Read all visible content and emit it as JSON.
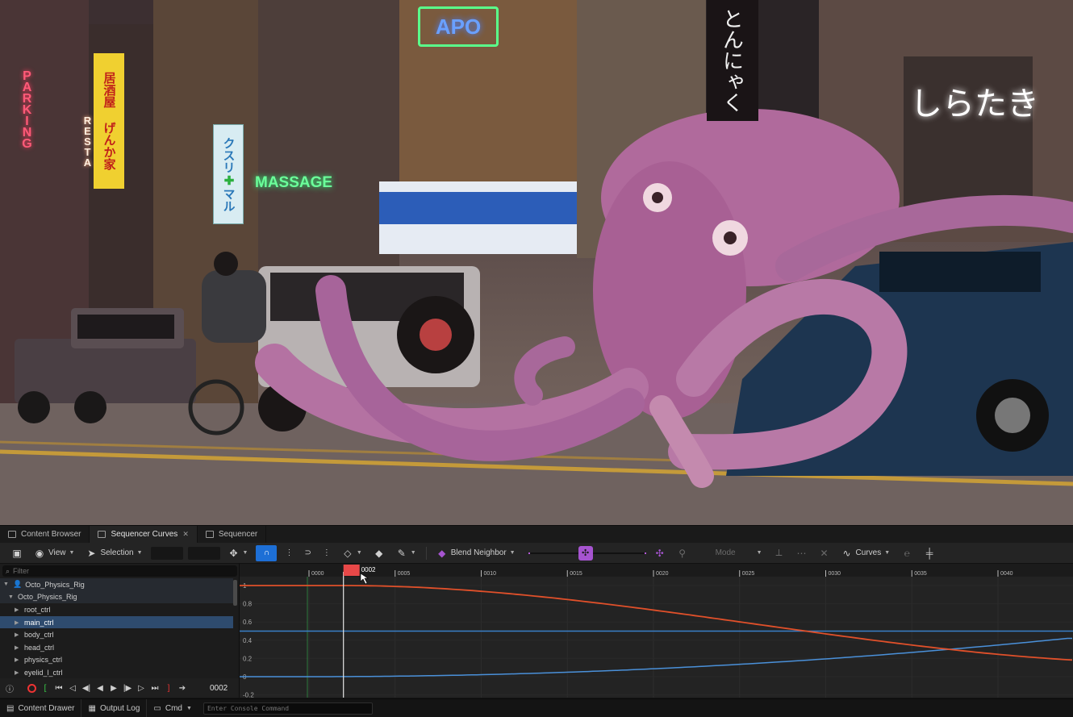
{
  "viewport": {
    "signs": {
      "parking": "PARKING",
      "resta": "RESTA",
      "massage": "MASSAGE",
      "apo": "APO",
      "kusuri": "クスリ",
      "maru": "マル",
      "vertical_right": "とんにゃく",
      "shirataki": "しらたき",
      "izakaya": "居酒屋 げんか家"
    }
  },
  "tabs": [
    {
      "label": "Content Browser",
      "icon": "folder-icon"
    },
    {
      "label": "Sequencer Curves",
      "icon": "curves-icon",
      "active": true
    },
    {
      "label": "Sequencer",
      "icon": "film-icon"
    }
  ],
  "toolbar": {
    "view_label": "View",
    "selection_label": "Selection",
    "blend_label": "Blend Neighbor",
    "mode_label": "Mode",
    "curves_label": "Curves",
    "accent_blue": "#1d6fd6",
    "accent_purple": "#a654d0"
  },
  "outliner": {
    "filter_placeholder": "Filter",
    "items": [
      {
        "label": "Octo_Physics_Rig",
        "level": 0
      },
      {
        "label": "Octo_Physics_Rig",
        "level": 1
      },
      {
        "label": "root_ctrl",
        "level": 2
      },
      {
        "label": "main_ctrl",
        "level": 2,
        "selected": true
      },
      {
        "label": "body_ctrl",
        "level": 2
      },
      {
        "label": "head_ctrl",
        "level": 2
      },
      {
        "label": "physics_ctrl",
        "level": 2
      },
      {
        "label": "eyelid_l_ctrl",
        "level": 2
      }
    ]
  },
  "transport": {
    "current_frame": "0002"
  },
  "curve_editor": {
    "frame_ticks": [
      "0000",
      "0005",
      "0010",
      "0015",
      "0020",
      "0025",
      "0030",
      "0035",
      "0040"
    ],
    "current_frame": "0002",
    "y_labels": [
      "1",
      "0.8",
      "0.6",
      "0.4",
      "0.2",
      "0",
      "-0.2"
    ],
    "curve_colors": {
      "red": "#e0502a",
      "blue": "#4a90d9",
      "flat": "#3a7fc8"
    }
  },
  "statusbar": {
    "content_drawer": "Content Drawer",
    "output_log": "Output Log",
    "cmd": "Cmd",
    "console_placeholder": "Enter Console Command"
  }
}
